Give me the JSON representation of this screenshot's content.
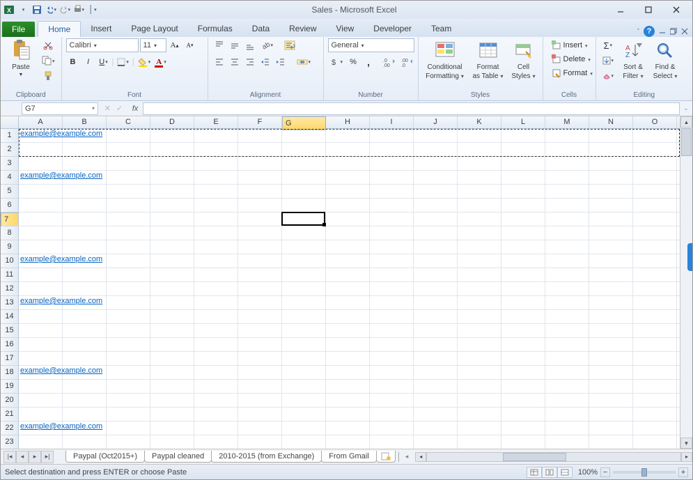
{
  "titlebar": {
    "title": "Sales  -  Microsoft Excel"
  },
  "tabs": {
    "file": "File",
    "items": [
      "Home",
      "Insert",
      "Page Layout",
      "Formulas",
      "Data",
      "Review",
      "View",
      "Developer",
      "Team"
    ],
    "active": "Home"
  },
  "ribbon": {
    "clipboard": {
      "paste": "Paste",
      "label": "Clipboard"
    },
    "font": {
      "name": "Calibri",
      "size": "11",
      "label": "Font"
    },
    "alignment": {
      "label": "Alignment"
    },
    "number": {
      "format": "General",
      "label": "Number"
    },
    "styles": {
      "cond": "Conditional",
      "cond2": "Formatting",
      "table": "Format",
      "table2": "as Table",
      "cell": "Cell",
      "cell2": "Styles",
      "label": "Styles"
    },
    "cells": {
      "insert": "Insert",
      "delete": "Delete",
      "format": "Format",
      "label": "Cells"
    },
    "editing": {
      "sort": "Sort &",
      "sort2": "Filter",
      "find": "Find &",
      "find2": "Select",
      "label": "Editing"
    }
  },
  "formula_bar": {
    "cell_ref": "G7",
    "formula": ""
  },
  "columns": [
    "A",
    "B",
    "C",
    "D",
    "E",
    "F",
    "G",
    "H",
    "I",
    "J",
    "K",
    "L",
    "M",
    "N",
    "O"
  ],
  "selected_col_index": 6,
  "selected_row_index": 6,
  "rows": [
    {
      "n": 1,
      "link": "example@example.com"
    },
    {
      "n": 2
    },
    {
      "n": 3
    },
    {
      "n": 4,
      "link": "example@example.com"
    },
    {
      "n": 5
    },
    {
      "n": 6
    },
    {
      "n": 7
    },
    {
      "n": 8
    },
    {
      "n": 9
    },
    {
      "n": 10,
      "link": "example@example.com"
    },
    {
      "n": 11
    },
    {
      "n": 12
    },
    {
      "n": 13,
      "link": "example@example.com"
    },
    {
      "n": 14
    },
    {
      "n": 15
    },
    {
      "n": 16
    },
    {
      "n": 17
    },
    {
      "n": 18,
      "link": "example@example.com"
    },
    {
      "n": 19
    },
    {
      "n": 20
    },
    {
      "n": 21
    },
    {
      "n": 22,
      "link": "example@example.com"
    },
    {
      "n": 23
    }
  ],
  "sheets": [
    "Paypal (Oct2015+)",
    "Paypal cleaned",
    "2010-2015 (from Exchange)",
    "From Gmail"
  ],
  "status": {
    "msg": "Select destination and press ENTER or choose Paste",
    "zoom": "100%"
  }
}
